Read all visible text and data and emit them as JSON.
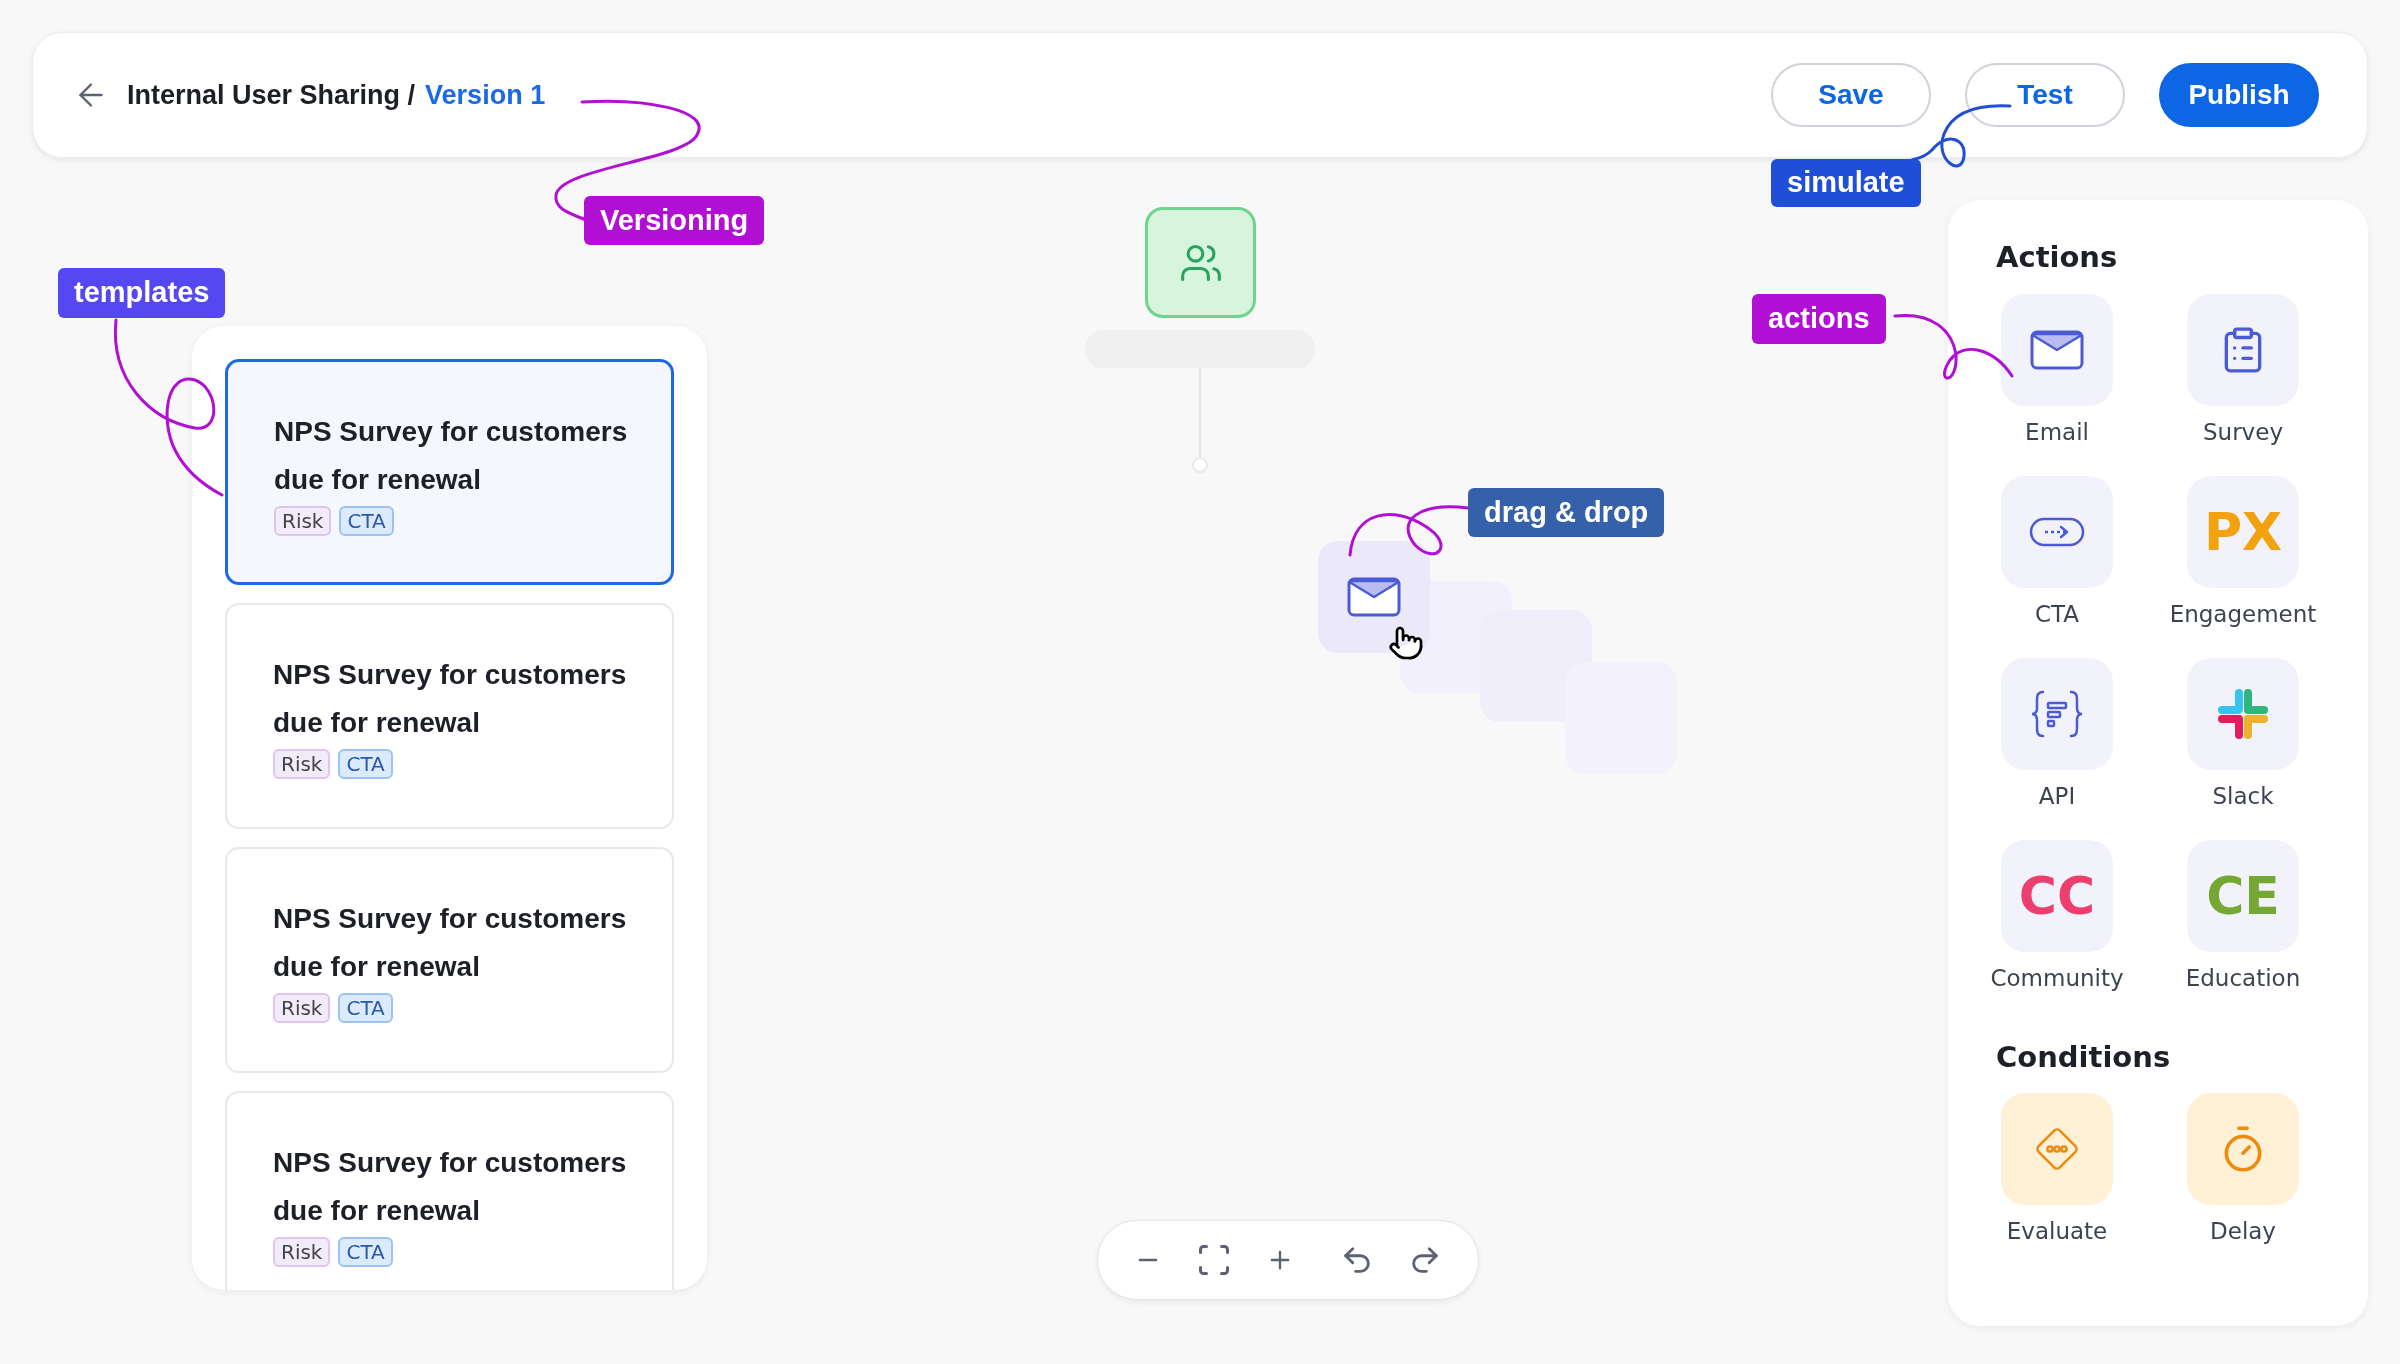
{
  "header": {
    "title": "Internal User Sharing /",
    "version": "Version 1",
    "buttons": [
      {
        "label": "Save",
        "kind": "outline"
      },
      {
        "label": "Test",
        "kind": "outline"
      },
      {
        "label": "Publish",
        "kind": "primary"
      }
    ]
  },
  "annotations": [
    {
      "text": "Versioning",
      "color": "#b20fd4"
    },
    {
      "text": "templates",
      "color": "#5548f2"
    },
    {
      "text": "simulate",
      "color": "#1f4fd8"
    },
    {
      "text": "actions",
      "color": "#b20fd4"
    },
    {
      "text": "drag & drop",
      "color": "#3561aa"
    }
  ],
  "templates": [
    {
      "title": "NPS Survey for customers due for renewal",
      "selected": true,
      "tags": [
        {
          "label": "Risk",
          "kind": "risk"
        },
        {
          "label": "CTA",
          "kind": "cta"
        }
      ]
    },
    {
      "title": "NPS Survey for customers due for renewal",
      "selected": false,
      "tags": [
        {
          "label": "Risk",
          "kind": "risk"
        },
        {
          "label": "CTA",
          "kind": "cta"
        }
      ]
    },
    {
      "title": "NPS Survey for customers due for renewal",
      "selected": false,
      "tags": [
        {
          "label": "Risk",
          "kind": "risk"
        },
        {
          "label": "CTA",
          "kind": "cta"
        }
      ]
    },
    {
      "title": "NPS Survey for customers due for renewal",
      "selected": false,
      "tags": [
        {
          "label": "Risk",
          "kind": "risk"
        },
        {
          "label": "CTA",
          "kind": "cta"
        }
      ]
    }
  ],
  "actions": {
    "heading": "Actions",
    "rows": [
      {
        "items": [
          {
            "label": "Email",
            "kind": "email"
          },
          {
            "label": "Survey",
            "kind": "survey"
          }
        ]
      },
      {
        "items": [
          {
            "label": "CTA",
            "kind": "cta"
          },
          {
            "label": "Engagement",
            "kind": "monogram",
            "glyph": "PX",
            "color": "#f2a10f"
          }
        ]
      },
      {
        "items": [
          {
            "label": "API",
            "kind": "api"
          },
          {
            "label": "Slack",
            "kind": "slack"
          }
        ]
      },
      {
        "items": [
          {
            "label": "Community",
            "kind": "monogram",
            "glyph": "CC",
            "color": "#ec3f6e"
          },
          {
            "label": "Education",
            "kind": "monogram",
            "glyph": "CE",
            "color": "#74a832"
          }
        ]
      }
    ]
  },
  "conditions": {
    "heading": "Conditions",
    "items": [
      {
        "label": "Evaluate",
        "kind": "evaluate"
      },
      {
        "label": "Delay",
        "kind": "delay"
      }
    ]
  }
}
